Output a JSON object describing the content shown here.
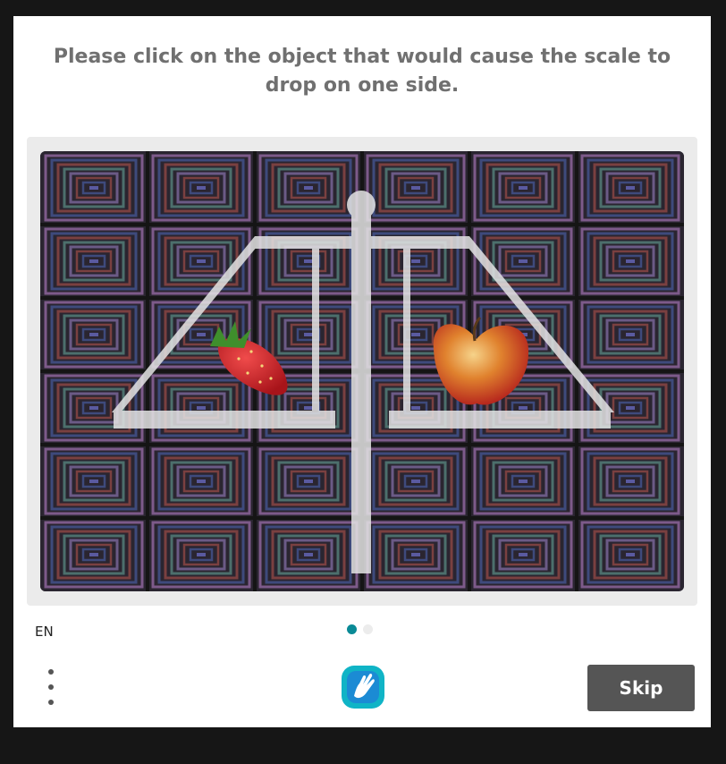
{
  "prompt": "Please click on the object that would cause the scale to drop on one side.",
  "challenge": {
    "objects": [
      "strawberry",
      "apple"
    ]
  },
  "footer": {
    "language": "EN",
    "pages": 2,
    "current_page": 1,
    "skip_label": "Skip",
    "menu_icon": "kebab-menu-icon",
    "logo_icon": "hcaptcha-hand-logo-icon"
  },
  "colors": {
    "accent": "#0a8a96",
    "skip_button": "#555555",
    "prompt_text": "#707070"
  }
}
